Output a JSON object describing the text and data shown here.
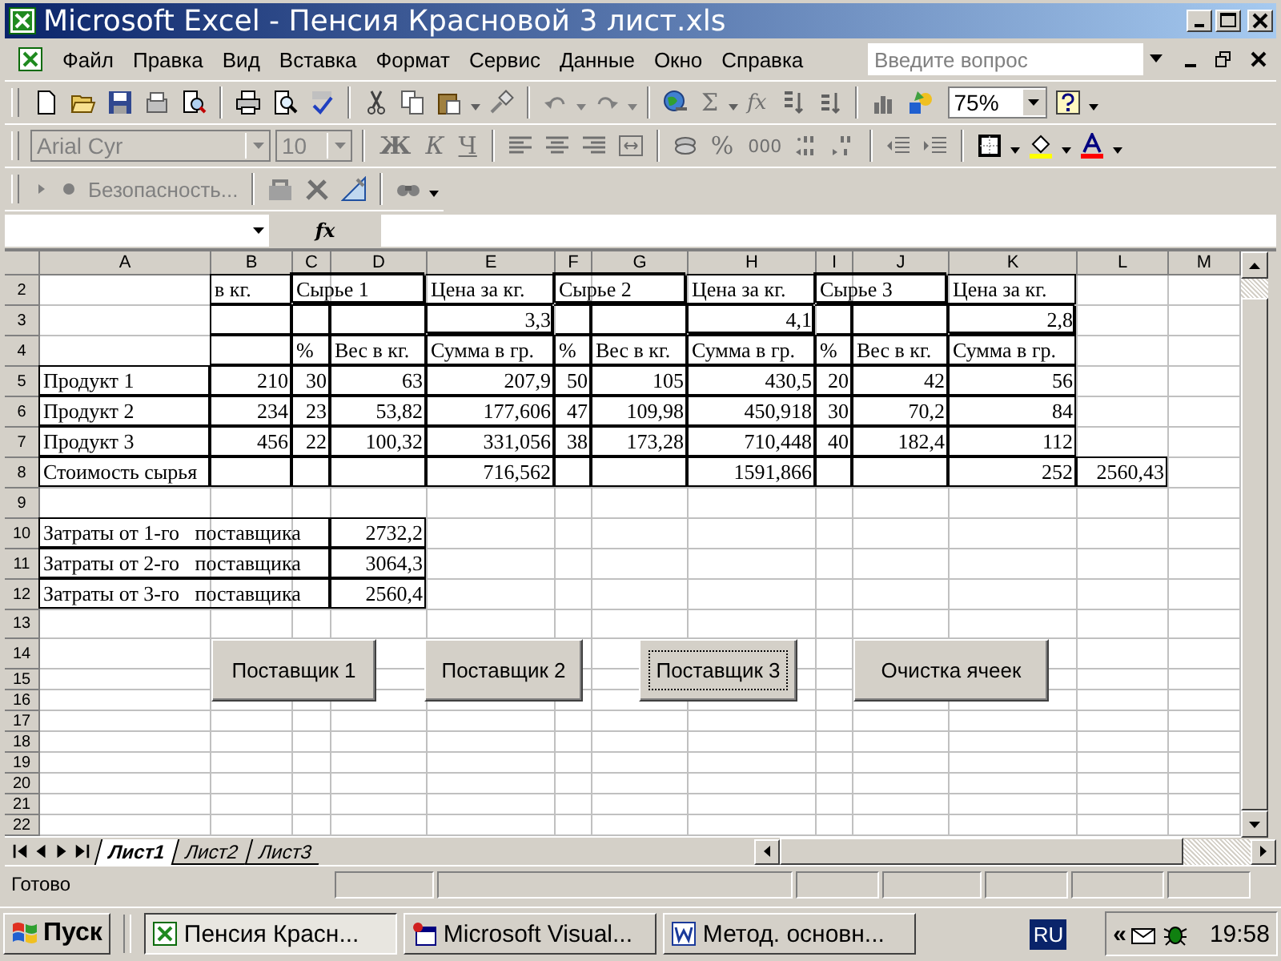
{
  "window": {
    "title": "Microsoft Excel - Пенсия Красновой 3 лист.xls"
  },
  "menu": [
    "Файл",
    "Правка",
    "Вид",
    "Вставка",
    "Формат",
    "Сервис",
    "Данные",
    "Окно",
    "Справка"
  ],
  "help_search": {
    "placeholder": "Введите вопрос"
  },
  "standard_toolbar": {
    "sum": "Σ",
    "function": "fx",
    "zoom": "75%"
  },
  "formatting_toolbar": {
    "font": "Arial Cyr",
    "size": "10",
    "bold": "Ж",
    "italic": "К",
    "underline": "Ч",
    "percent": "%",
    "thousands": "000"
  },
  "security_toolbar": {
    "label": "Безопасность..."
  },
  "formula_bar": {
    "function": "fx"
  },
  "columns": [
    "A",
    "B",
    "C",
    "D",
    "E",
    "F",
    "G",
    "H",
    "I",
    "J",
    "K",
    "L",
    "M"
  ],
  "rows": [
    {
      "number": "2",
      "cells": {
        "B": {
          "text": "в кг.",
          "kind": "text",
          "boxed": true,
          "thick": false
        },
        "C": {
          "text": "Сырье 1",
          "kind": "text",
          "boxed": true,
          "thick": true,
          "merged": true
        },
        "E": {
          "text": "Цена за кг.",
          "kind": "text",
          "boxed": true,
          "thick": false
        },
        "F": {
          "text": "Сырье 2",
          "kind": "text",
          "boxed": true,
          "thick": true,
          "merged": true
        },
        "H": {
          "text": "Цена за кг.",
          "kind": "text",
          "boxed": true,
          "thick": false
        },
        "I": {
          "text": "Сырье 3",
          "kind": "text",
          "boxed": true,
          "thick": true,
          "merged": true
        },
        "K": {
          "text": "Цена за кг.",
          "kind": "text",
          "boxed": true,
          "thick": false
        }
      }
    },
    {
      "number": "3",
      "cells": {
        "B": {
          "boxed": true,
          "thick": false
        },
        "C": {
          "boxed": true,
          "thick": false
        },
        "D": {
          "boxed": true,
          "thick": false
        },
        "E": {
          "text": "3,3",
          "kind": "number",
          "boxed": true,
          "thick": true
        },
        "F": {
          "boxed": true,
          "thick": false
        },
        "G": {
          "boxed": true,
          "thick": false
        },
        "H": {
          "text": "4,1",
          "kind": "number",
          "boxed": true,
          "thick": true
        },
        "I": {
          "boxed": true,
          "thick": false
        },
        "J": {
          "boxed": true,
          "thick": false
        },
        "K": {
          "text": "2,8",
          "kind": "number",
          "boxed": true,
          "thick": true
        }
      }
    },
    {
      "number": "4",
      "cells": {
        "B": {
          "boxed": true,
          "thick": false
        },
        "C": {
          "text": "%",
          "kind": "text",
          "boxed": true,
          "thick": false
        },
        "D": {
          "text": "Вес в кг.",
          "kind": "text",
          "boxed": true,
          "thick": false
        },
        "E": {
          "text": "Сумма в гр.",
          "kind": "text",
          "boxed": true,
          "thick": false
        },
        "F": {
          "text": "%",
          "kind": "text",
          "boxed": true,
          "thick": false
        },
        "G": {
          "text": "Вес в кг.",
          "kind": "text",
          "boxed": true,
          "thick": false
        },
        "H": {
          "text": "Сумма в гр.",
          "kind": "text",
          "boxed": true,
          "thick": false
        },
        "I": {
          "text": "%",
          "kind": "text",
          "boxed": true,
          "thick": false
        },
        "J": {
          "text": "Вес в кг.",
          "kind": "text",
          "boxed": true,
          "thick": false
        },
        "K": {
          "text": "Сумма в гр.",
          "kind": "text",
          "boxed": true,
          "thick": false
        }
      }
    },
    {
      "number": "5",
      "cells": {
        "A": {
          "text": "Продукт 1",
          "kind": "text",
          "boxed": true,
          "thick": false
        },
        "B": {
          "text": "210",
          "kind": "number",
          "boxed": true,
          "thick": false
        },
        "C": {
          "text": "30",
          "kind": "number",
          "boxed": true,
          "thick": false
        },
        "D": {
          "text": "63",
          "kind": "number",
          "boxed": true,
          "thick": false
        },
        "E": {
          "text": "207,9",
          "kind": "number",
          "boxed": true,
          "thick": false
        },
        "F": {
          "text": "50",
          "kind": "number",
          "boxed": true,
          "thick": false
        },
        "G": {
          "text": "105",
          "kind": "number",
          "boxed": true,
          "thick": false
        },
        "H": {
          "text": "430,5",
          "kind": "number",
          "boxed": true,
          "thick": false
        },
        "I": {
          "text": "20",
          "kind": "number",
          "boxed": true,
          "thick": false
        },
        "J": {
          "text": "42",
          "kind": "number",
          "boxed": true,
          "thick": false
        },
        "K": {
          "text": "56",
          "kind": "number",
          "boxed": true,
          "thick": false
        }
      }
    },
    {
      "number": "6",
      "cells": {
        "A": {
          "text": "Продукт 2",
          "kind": "text",
          "boxed": true,
          "thick": false
        },
        "B": {
          "text": "234",
          "kind": "number",
          "boxed": true,
          "thick": false
        },
        "C": {
          "text": "23",
          "kind": "number",
          "boxed": true,
          "thick": false
        },
        "D": {
          "text": "53,82",
          "kind": "number",
          "boxed": true,
          "thick": false
        },
        "E": {
          "text": "177,606",
          "kind": "number",
          "boxed": true,
          "thick": false
        },
        "F": {
          "text": "47",
          "kind": "number",
          "boxed": true,
          "thick": false
        },
        "G": {
          "text": "109,98",
          "kind": "number",
          "boxed": true,
          "thick": false
        },
        "H": {
          "text": "450,918",
          "kind": "number",
          "boxed": true,
          "thick": false
        },
        "I": {
          "text": "30",
          "kind": "number",
          "boxed": true,
          "thick": false
        },
        "J": {
          "text": "70,2",
          "kind": "number",
          "boxed": true,
          "thick": false
        },
        "K": {
          "text": "84",
          "kind": "number",
          "boxed": true,
          "thick": false
        }
      }
    },
    {
      "number": "7",
      "cells": {
        "A": {
          "text": "Продукт 3",
          "kind": "text",
          "boxed": true,
          "thick": false
        },
        "B": {
          "text": "456",
          "kind": "number",
          "boxed": true,
          "thick": false
        },
        "C": {
          "text": "22",
          "kind": "number",
          "boxed": true,
          "thick": false
        },
        "D": {
          "text": "100,32",
          "kind": "number",
          "boxed": true,
          "thick": false
        },
        "E": {
          "text": "331,056",
          "kind": "number",
          "boxed": true,
          "thick": false
        },
        "F": {
          "text": "38",
          "kind": "number",
          "boxed": true,
          "thick": false
        },
        "G": {
          "text": "173,28",
          "kind": "number",
          "boxed": true,
          "thick": false
        },
        "H": {
          "text": "710,448",
          "kind": "number",
          "boxed": true,
          "thick": false
        },
        "I": {
          "text": "40",
          "kind": "number",
          "boxed": true,
          "thick": false
        },
        "J": {
          "text": "182,4",
          "kind": "number",
          "boxed": true,
          "thick": false
        },
        "K": {
          "text": "112",
          "kind": "number",
          "boxed": true,
          "thick": false
        }
      }
    },
    {
      "number": "8",
      "cells": {
        "A": {
          "text": "Стоимость сырья",
          "kind": "text",
          "boxed": true,
          "thick": false
        },
        "B": {
          "boxed": true,
          "thick": false
        },
        "C": {
          "boxed": true,
          "thick": false
        },
        "D": {
          "boxed": true,
          "thick": false
        },
        "E": {
          "text": "716,562",
          "kind": "number",
          "boxed": true,
          "thick": false
        },
        "F": {
          "boxed": true,
          "thick": false
        },
        "G": {
          "boxed": true,
          "thick": false
        },
        "H": {
          "text": "1591,866",
          "kind": "number",
          "boxed": true,
          "thick": false
        },
        "I": {
          "boxed": true,
          "thick": false
        },
        "J": {
          "boxed": true,
          "thick": false
        },
        "K": {
          "text": "252",
          "kind": "number",
          "boxed": true,
          "thick": false
        },
        "L": {
          "text": "2560,43",
          "kind": "number",
          "boxed": true,
          "thick": false
        }
      }
    },
    {
      "number": "9"
    },
    {
      "number": "10",
      "cells": {
        "A": {
          "text": "Затраты от 1-го   поставщика",
          "kind": "text",
          "boxed": true,
          "thick": false,
          "merged": true
        },
        "D": {
          "text": "2732,2",
          "kind": "number",
          "boxed": true,
          "thick": false
        }
      }
    },
    {
      "number": "11",
      "cells": {
        "A": {
          "text": "Затраты от 2-го   поставщика",
          "kind": "text",
          "boxed": true,
          "thick": false,
          "merged": true
        },
        "D": {
          "text": "3064,3",
          "kind": "number",
          "boxed": true,
          "thick": false
        }
      }
    },
    {
      "number": "12",
      "cells": {
        "A": {
          "text": "Затраты от 3-го   поставщика",
          "kind": "text",
          "boxed": true,
          "thick": false,
          "merged": true
        },
        "D": {
          "text": "2560,4",
          "kind": "number",
          "boxed": true,
          "thick": false
        }
      }
    },
    {
      "number": "13"
    },
    {
      "number": "14"
    },
    {
      "number": "15"
    },
    {
      "number": "16"
    },
    {
      "number": "17"
    },
    {
      "number": "18"
    },
    {
      "number": "19"
    },
    {
      "number": "20"
    },
    {
      "number": "21"
    },
    {
      "number": "22"
    }
  ],
  "buttons": [
    {
      "label": "Поставщик 1",
      "focused": false
    },
    {
      "label": "Поставщик 2",
      "focused": false
    },
    {
      "label": "Поставщик 3",
      "focused": true
    },
    {
      "label": "Очистка ячеек",
      "focused": false
    }
  ],
  "sheet_tabs": [
    {
      "label": "Лист1",
      "selected": true
    },
    {
      "label": "Лист2",
      "selected": false
    },
    {
      "label": "Лист3",
      "selected": false
    }
  ],
  "status_bar": {
    "text": "Готово"
  },
  "taskbar": {
    "start": "Пуск",
    "tasks": [
      {
        "label": "Пенсия Красн...",
        "selected": true,
        "kind": "excel"
      },
      {
        "label": "Microsoft Visual...",
        "selected": false,
        "kind": "vb"
      },
      {
        "label": "Метод. основн...",
        "selected": false,
        "kind": "word"
      }
    ],
    "language": "RU",
    "chevron": "«",
    "clock": "19:58"
  }
}
